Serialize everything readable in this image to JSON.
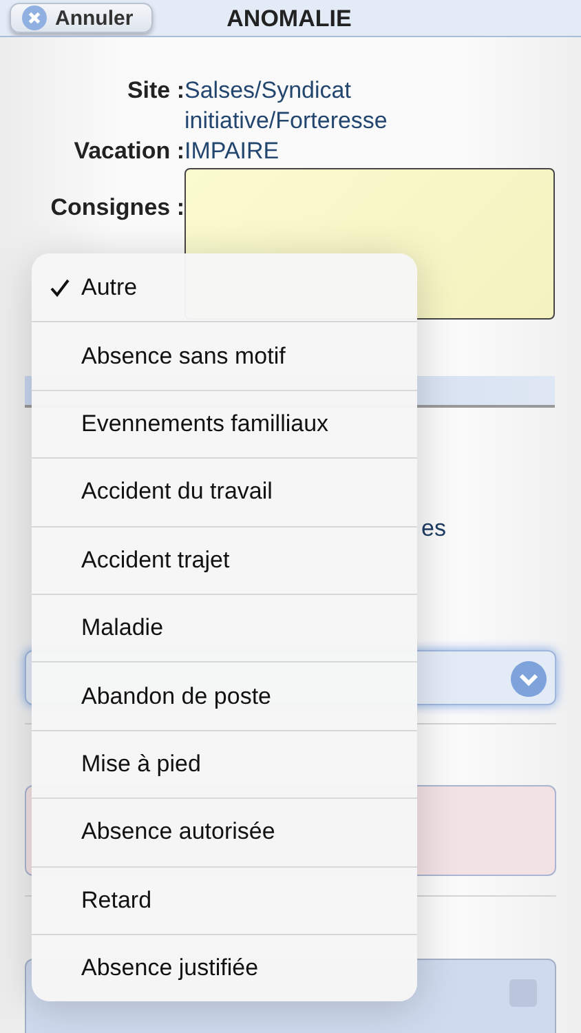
{
  "header": {
    "cancel_button": "Annuler",
    "title": "ANOMALIE"
  },
  "info": [
    {
      "label": "Site :",
      "value": "Salses/Syndicat initiative/Forteresse"
    },
    {
      "label": "Vacation :",
      "value": "IMPAIRE"
    }
  ],
  "consignes": {
    "label": "Consignes :"
  },
  "hidden_fragment": "es",
  "list_panel": {
    "checked": false
  },
  "menu": [
    {
      "label": "Autre",
      "selected": true
    },
    {
      "label": "Absence sans motif",
      "selected": false
    },
    {
      "label": "Evennements familliaux",
      "selected": false
    },
    {
      "label": "Accident du travail",
      "selected": false
    },
    {
      "label": "Accident trajet",
      "selected": false
    },
    {
      "label": "Maladie",
      "selected": false
    },
    {
      "label": "Abandon de poste",
      "selected": false
    },
    {
      "label": "Mise à pied",
      "selected": false
    },
    {
      "label": "Absence autorisée",
      "selected": false
    },
    {
      "label": "Retard",
      "selected": false
    },
    {
      "label": "Absence justifiée",
      "selected": false
    }
  ]
}
